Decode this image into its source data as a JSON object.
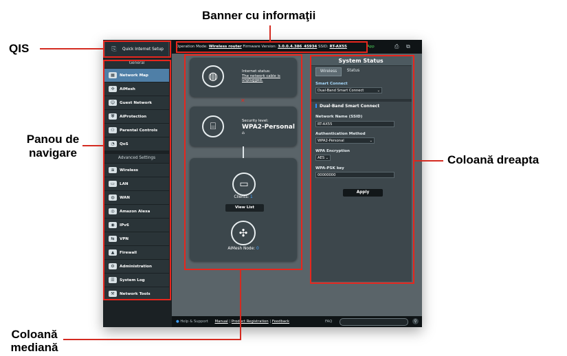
{
  "annotations": {
    "banner": "Banner cu informaţii",
    "qis": "QIS",
    "nav_line1": "Panou de",
    "nav_line2": "navigare",
    "right": "Coloană dreapta",
    "middle_line1": "Coloană",
    "middle_line2": "mediană"
  },
  "banner": {
    "op_mode_label": "Operation Mode:",
    "op_mode_value": "Wireless router",
    "fw_label": "Firmware Version:",
    "fw_value": "3.0.0.4.386_45934",
    "ssid_label": "SSID:",
    "ssid_value": "RT-AX55",
    "app": "App"
  },
  "qis": {
    "label": "Quick Internet Setup"
  },
  "nav": {
    "general_header": "General",
    "general_items": [
      {
        "label": "Network Map",
        "icon": "network-map-icon"
      },
      {
        "label": "AiMesh",
        "icon": "aimesh-icon"
      },
      {
        "label": "Guest Network",
        "icon": "guest-network-icon"
      },
      {
        "label": "AiProtection",
        "icon": "shield-icon"
      },
      {
        "label": "Parental Controls",
        "icon": "parental-icon"
      },
      {
        "label": "QoS",
        "icon": "qos-icon"
      }
    ],
    "advanced_header": "Advanced Settings",
    "advanced_items": [
      {
        "label": "Wireless",
        "icon": "wireless-icon"
      },
      {
        "label": "LAN",
        "icon": "lan-icon"
      },
      {
        "label": "WAN",
        "icon": "globe-icon"
      },
      {
        "label": "Amazon Alexa",
        "icon": "alexa-icon"
      },
      {
        "label": "IPv6",
        "icon": "ipv6-icon"
      },
      {
        "label": "VPN",
        "icon": "vpn-icon"
      },
      {
        "label": "Firewall",
        "icon": "firewall-icon"
      },
      {
        "label": "Administration",
        "icon": "admin-icon"
      },
      {
        "label": "System Log",
        "icon": "log-icon"
      },
      {
        "label": "Network Tools",
        "icon": "tools-icon"
      }
    ]
  },
  "middle": {
    "internet_status_label": "Internet status:",
    "internet_status_value": "The network cable is unplugged.",
    "security_label": "Security level:",
    "security_value": "WPA2-Personal",
    "clients_label": "Clients:",
    "clients_count": "1",
    "view_list": "View List",
    "aimesh_label": "AiMesh Node:",
    "aimesh_count": "0"
  },
  "status": {
    "title": "System Status",
    "tabs": [
      "Wireless",
      "Status"
    ],
    "smart_connect_label": "Smart Connect",
    "smart_connect_value": "Dual-Band Smart Connect",
    "section_title": "Dual-Band Smart Connect",
    "ssid_label": "Network Name (SSID)",
    "ssid_value": "RT-AX55",
    "auth_label": "Authentication Method",
    "auth_value": "WPA2-Personal",
    "enc_label": "WPA Encryption",
    "enc_value": "AES",
    "psk_label": "WPA-PSK key",
    "psk_value": "00000000",
    "apply": "Apply"
  },
  "footer": {
    "help": "Help & Support",
    "manual": "Manual",
    "registration": "Product Registration",
    "feedback": "Feedback",
    "faq": "FAQ"
  },
  "colors": {
    "accent": "#e8261d",
    "nav_selected": "#4f7fa7",
    "link_blue": "#3fa0ff"
  }
}
